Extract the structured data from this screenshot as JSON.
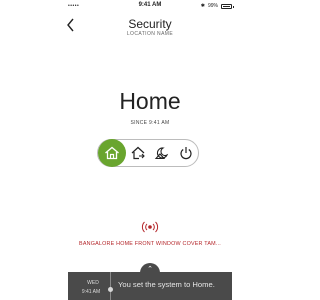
{
  "status_bar": {
    "signal": "•••••",
    "time": "9:41 AM",
    "battery_text": "99%"
  },
  "header": {
    "back_icon": "chevron-left-icon",
    "title": "Security",
    "subtitle": "LOCATION NAME"
  },
  "mode": {
    "current": "Home",
    "since": "SINCE 9:41 AM",
    "accent_color": "#69a52e",
    "options": [
      {
        "name": "home",
        "icon": "home-icon",
        "active": true
      },
      {
        "name": "away",
        "icon": "away-icon",
        "active": false
      },
      {
        "name": "night",
        "icon": "night-icon",
        "active": false
      },
      {
        "name": "off",
        "icon": "power-icon",
        "active": false
      }
    ]
  },
  "alert": {
    "icon": "siren-icon",
    "text": "BANGALORE HOME FRONT WINDOW COVER TAM...",
    "color": "#b4262a"
  },
  "activity": {
    "handle_icon": "chevron-up-icon",
    "day": "WED",
    "time": "9:41 AM",
    "message": "You set the system to Home."
  }
}
